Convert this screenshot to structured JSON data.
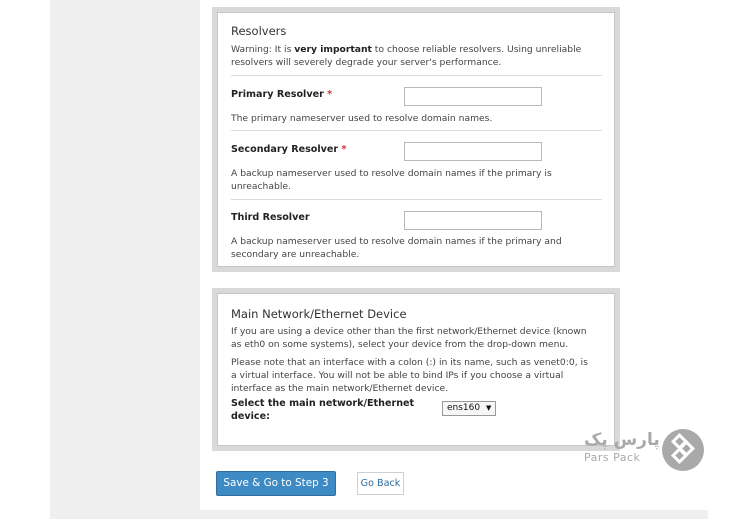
{
  "resolvers": {
    "title": "Resolvers",
    "warning_pre": "Warning: It is ",
    "warning_bold": "very important",
    "warning_post": " to choose reliable resolvers. Using unreliable resolvers will severely degrade your server's performance.",
    "primary": {
      "label": "Primary Resolver",
      "required": "*",
      "value": "",
      "help": "The primary nameserver used to resolve domain names."
    },
    "secondary": {
      "label": "Secondary Resolver",
      "required": "*",
      "value": "",
      "help": "A backup nameserver used to resolve domain names if the primary is unreachable."
    },
    "third": {
      "label": "Third Resolver",
      "value": "",
      "help": "A backup nameserver used to resolve domain names if the primary and secondary are unreachable."
    }
  },
  "network": {
    "title": "Main Network/Ethernet Device",
    "note1": "If you are using a device other than the first network/Ethernet device (known as eth0 on some systems), select your device from the drop-down menu.",
    "note2": "Please note that an interface with a colon (:) in its name, such as venet0:0, is a virtual interface. You will not be able to bind IPs if you choose a virtual interface as the main network/Ethernet device.",
    "select_label": "Select the main network/Ethernet device:",
    "selected_value": "ens160",
    "caret": "▼"
  },
  "actions": {
    "save_label": "Save & Go to Step 3",
    "back_label": "Go Back"
  },
  "watermark": {
    "text_fa": "پارس پک",
    "text_en": "Pars Pack"
  }
}
